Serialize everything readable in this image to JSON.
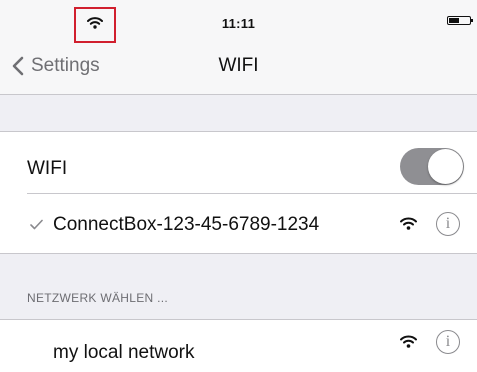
{
  "status_bar": {
    "time": "11:11",
    "wifi_icon": "wifi-icon",
    "highlight_color": "#d11f2e"
  },
  "nav": {
    "back_label": "Settings",
    "title": "WIFI"
  },
  "wifi_row": {
    "label": "WIFI",
    "toggle_on": true
  },
  "connected_network": {
    "check_icon": "checkmark-icon",
    "name": "ConnectBox-123-45-6789-1234",
    "info_glyph": "i"
  },
  "networks_section": {
    "header": "NETZWERK WÄHLEN ...",
    "items": [
      {
        "name": "my local network",
        "info_glyph": "i"
      }
    ]
  }
}
